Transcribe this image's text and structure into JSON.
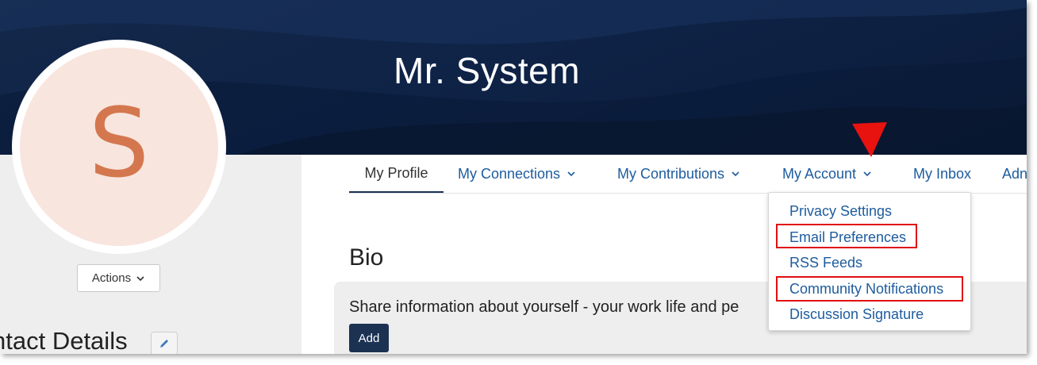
{
  "profile": {
    "name": "Mr. System",
    "avatar_initial": "S",
    "actions_label": "Actions",
    "contact_details_title": "ntact Details"
  },
  "tabs": [
    {
      "label": "My Profile",
      "active": true
    },
    {
      "label": "My Connections",
      "has_dropdown": true
    },
    {
      "label": "My Contributions",
      "has_dropdown": true
    },
    {
      "label": "My Account",
      "has_dropdown": true
    },
    {
      "label": "My Inbox"
    },
    {
      "label": "Adn"
    }
  ],
  "account_menu": {
    "items": [
      {
        "label": "Privacy Settings",
        "highlighted": false
      },
      {
        "label": "Email Preferences",
        "highlighted": true
      },
      {
        "label": "RSS Feeds",
        "highlighted": false
      },
      {
        "label": "Community Notifications",
        "highlighted": true
      },
      {
        "label": "Discussion Signature",
        "highlighted": false
      }
    ]
  },
  "bio": {
    "title": "Bio",
    "prompt": "Share information about yourself - your work life and pe",
    "add_label": "Add"
  },
  "colors": {
    "banner": "#0f2347",
    "link": "#1d5c9e",
    "primary_button": "#1b3253",
    "avatar_bg": "#f8e5de",
    "avatar_letter": "#d4774f",
    "annotation": "#e01010"
  },
  "icons": {
    "dropdown": "chevron-down-icon",
    "edit": "pencil-icon",
    "annotation": "red-arrow-pointer"
  }
}
